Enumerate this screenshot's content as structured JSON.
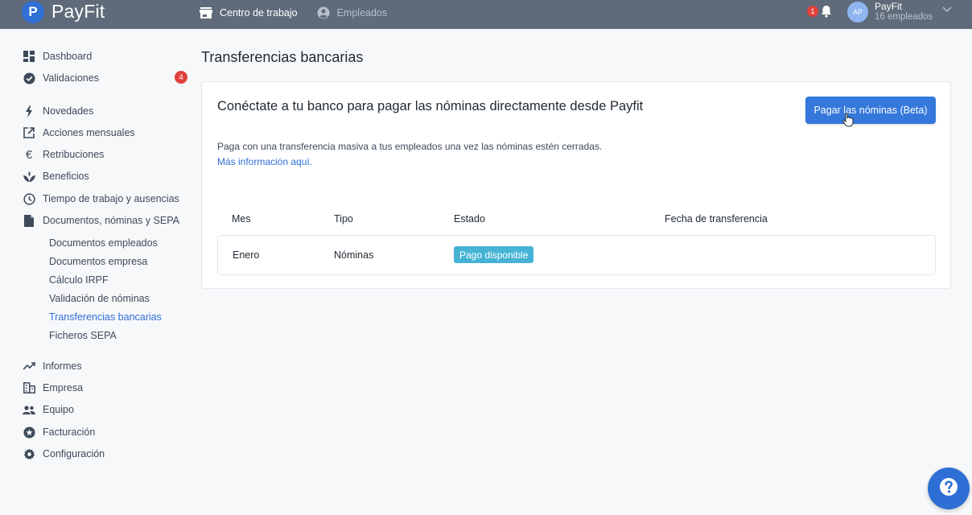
{
  "app": {
    "name": "PayFit",
    "logo_letter": "P"
  },
  "top_nav": {
    "workplace_label": "Centro de trabajo",
    "employees_label": "Empleados"
  },
  "notifications": {
    "count": "1"
  },
  "account": {
    "initials": "AP",
    "name": "PayFit",
    "subtitle": "16 empleados"
  },
  "sidebar": {
    "dashboard": "Dashboard",
    "validations": "Validaciones",
    "validations_badge": "4",
    "news": "Novedades",
    "monthly_actions": "Acciones mensuales",
    "compensation": "Retribuciones",
    "benefits": "Beneficios",
    "time": "Tiempo de trabajo y ausencias",
    "documents": "Documentos, nóminas y SEPA",
    "sub": {
      "employee_docs": "Documentos empleados",
      "company_docs": "Documentos empresa",
      "irpf": "Cálculo IRPF",
      "payroll_validation": "Validación de nóminas",
      "bank_transfers": "Transferencias bancarias",
      "sepa_files": "Ficheros SEPA"
    },
    "reports": "Informes",
    "company": "Empresa",
    "team": "Equipo",
    "billing": "Facturación",
    "settings": "Configuración"
  },
  "main": {
    "title": "Transferencias bancarias",
    "card": {
      "heading": "Conéctate a tu banco para pagar las nóminas directamente desde Payfit",
      "description": "Paga con una transferencia masiva a tus empleados una vez las nóminas estén cerradas.",
      "link": "Más información aquí.",
      "pay_button": "Pagar las nóminas (Beta)"
    },
    "table": {
      "columns": [
        "Mes",
        "Tipo",
        "Estado",
        "Fecha de transferencia"
      ],
      "rows": [
        {
          "month": "Enero",
          "type": "Nóminas",
          "status": "Pago disponible",
          "transfer_date": ""
        }
      ]
    }
  },
  "colors": {
    "primary": "#2f6fd6",
    "topbar": "#5f6b7a",
    "status": "#46b3d6",
    "badge": "#e0413b"
  },
  "icons": [
    "payfit-logo-icon",
    "store-icon",
    "user-circle-icon",
    "bell-icon",
    "chevron-down-icon",
    "help-icon"
  ]
}
